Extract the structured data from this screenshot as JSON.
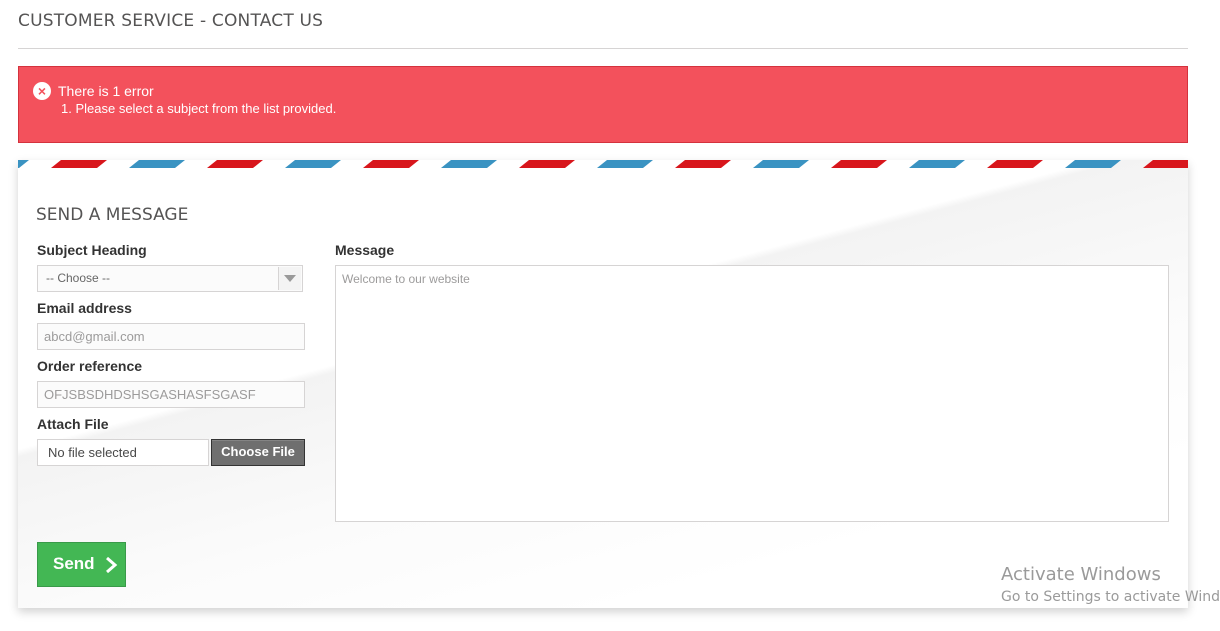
{
  "page": {
    "heading": "CUSTOMER SERVICE - CONTACT US"
  },
  "alert": {
    "title": "There is 1 error",
    "errors": [
      "1. Please select a subject from the list provided."
    ],
    "icon": "error-circle-x-icon",
    "color": "#f3515c"
  },
  "form": {
    "heading": "SEND A MESSAGE",
    "subject": {
      "label": "Subject Heading",
      "selected": "-- Choose --"
    },
    "email": {
      "label": "Email address",
      "value": "abcd@gmail.com"
    },
    "order": {
      "label": "Order reference",
      "value": "OFJSBSDHDSHSGASHASFSGASF"
    },
    "attach": {
      "label": "Attach File",
      "file_status": "No file selected",
      "button_label": "Choose File"
    },
    "message": {
      "label": "Message",
      "value": "Welcome to our website"
    },
    "send": {
      "label": "Send",
      "icon": "chevron-right-icon",
      "color": "#43b754"
    }
  },
  "airmail_colors": {
    "red": "#d8161c",
    "blue": "#3a93c2"
  },
  "watermark": {
    "title": "Activate Windows",
    "subtitle": "Go to Settings to activate Windows."
  }
}
